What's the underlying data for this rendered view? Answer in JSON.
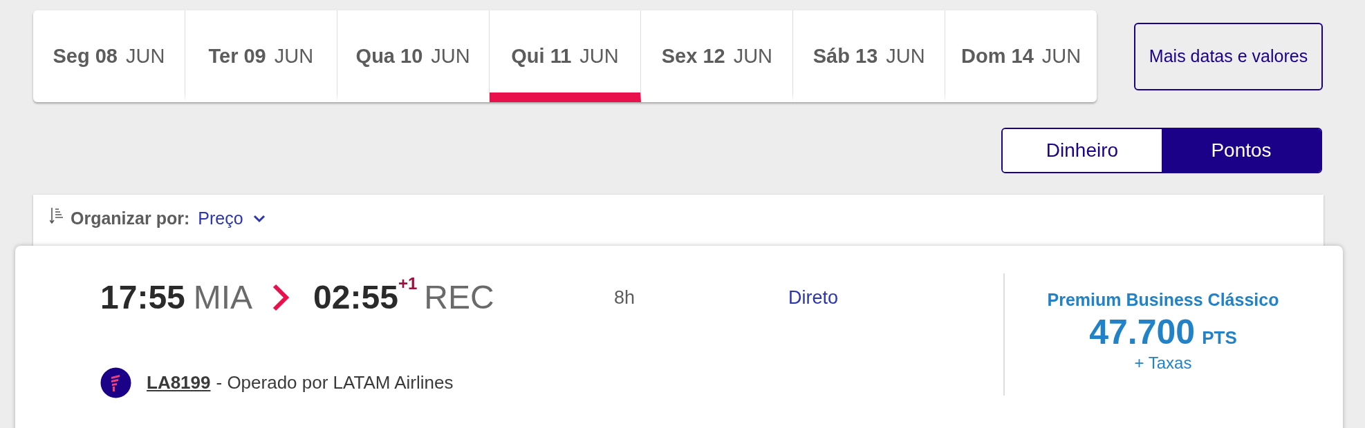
{
  "date_tabs": [
    {
      "weekday": "Seg",
      "day": "08",
      "month": "JUN",
      "selected": false
    },
    {
      "weekday": "Ter",
      "day": "09",
      "month": "JUN",
      "selected": false
    },
    {
      "weekday": "Qua",
      "day": "10",
      "month": "JUN",
      "selected": false
    },
    {
      "weekday": "Qui",
      "day": "11",
      "month": "JUN",
      "selected": true
    },
    {
      "weekday": "Sex",
      "day": "12",
      "month": "JUN",
      "selected": false
    },
    {
      "weekday": "Sáb",
      "day": "13",
      "month": "JUN",
      "selected": false
    },
    {
      "weekday": "Dom",
      "day": "14",
      "month": "JUN",
      "selected": false
    }
  ],
  "more_dates_button": "Mais datas e valores",
  "currency_toggle": [
    {
      "label": "Dinheiro",
      "selected": false
    },
    {
      "label": "Pontos",
      "selected": true
    }
  ],
  "sort": {
    "label": "Organizar por:",
    "value": "Preço"
  },
  "flight": {
    "departure_time": "17:55",
    "origin": "MIA",
    "arrival_time": "02:55",
    "day_offset": "+1",
    "destination": "REC",
    "duration": "8h",
    "stops": "Direto",
    "flight_number": "LA8199",
    "operator": "- Operado por LATAM Airlines",
    "fare": {
      "cabin": "Premium Business Clássico",
      "points": "47.700",
      "unit": "PTS",
      "taxes": "+ Taxas"
    }
  }
}
